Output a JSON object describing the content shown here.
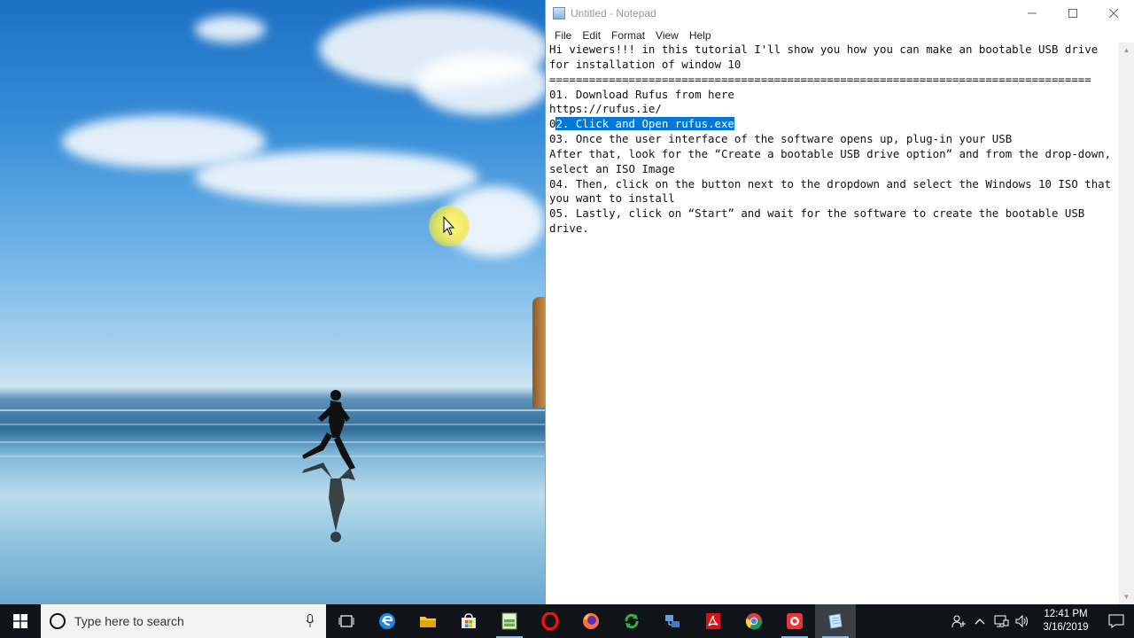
{
  "notepad": {
    "title": "Untitled - Notepad",
    "menus": [
      "File",
      "Edit",
      "Format",
      "View",
      "Help"
    ],
    "lines": [
      "Hi viewers!!! in this tutorial I'll show you how you can make an bootable USB drive",
      "for installation of window 10",
      "",
      "==================================================================================",
      "",
      "01. Download Rufus from here",
      "https://rufus.ie/",
      "",
      "{SEL}",
      "",
      "03. Once the user interface of the software opens up, plug-in your USB",
      "After that, look for the “Create a bootable USB drive option” and from the drop-down,",
      "select an ISO Image",
      "",
      "04. Then, click on the button next to the dropdown and select the Windows 10 ISO that",
      "you want to install",
      "",
      "05. Lastly, click on “Start” and wait for the software to create the bootable USB",
      "drive."
    ],
    "selected_line_prefix": "0",
    "selected_line_selection": "2. Click and Open rufus.exe"
  },
  "taskbar": {
    "search_placeholder": "Type here to search",
    "apps": [
      "task-view",
      "edge",
      "file-explorer",
      "store",
      "spreadsheet-app",
      "opera",
      "firefox",
      "sync-app",
      "network-app",
      "acrobat",
      "chrome",
      "recorder-app",
      "notepad"
    ],
    "time": "12:41 PM",
    "date": "3/16/2019"
  },
  "colors": {
    "selection": "#0078d7",
    "taskbar": "#101418"
  }
}
